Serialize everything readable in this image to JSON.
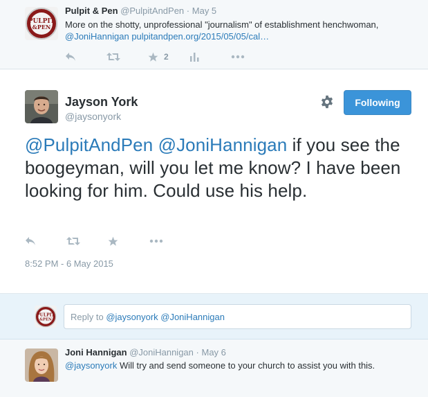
{
  "top_tweet": {
    "fullname": "Pulpit & Pen",
    "username": "@PulpitAndPen",
    "separator": "·",
    "date": "May 5",
    "text_plain": "More on the shotty, unprofessional \"journalism\" of establishment henchwoman,",
    "text_mention": "@JoniHannigan",
    "text_link": "pulpitandpen.org/2015/05/05/cal…",
    "favorite_count": "2",
    "avatar_text": "PULPIT & PEN",
    "icons": [
      "reply-icon",
      "retweet-icon",
      "favorite-icon",
      "analytics-icon",
      "more-icon"
    ]
  },
  "main_tweet": {
    "fullname": "Jayson York",
    "username": "@jaysonyork",
    "follow_label": "Following",
    "mention_1": "@PulpitAndPen",
    "mention_2": "@JoniHannigan",
    "text": " if you see the boogeyman, will you let me know? I have been looking for him. Could use his help.",
    "timestamp": "8:52 PM - 6 May 2015",
    "icons": [
      "gear-icon",
      "reply-icon",
      "retweet-icon",
      "favorite-icon",
      "more-icon"
    ]
  },
  "reply_box": {
    "prefix": "Reply to ",
    "mentions": "@jaysonyork @JoniHannigan"
  },
  "reply_tweet": {
    "fullname": "Joni Hannigan",
    "username": "@JoniHannigan",
    "separator": "·",
    "date": "May 6",
    "mention": "@jaysonyork",
    "text": " Will try and send someone to your church to assist you with this."
  },
  "colors": {
    "link": "#2b7bb9",
    "button": "#3b94d9",
    "muted": "#8899a6",
    "icon": "#aab8c2",
    "page_bg": "#f5f8fa",
    "reply_bg": "#e8f3fa"
  }
}
